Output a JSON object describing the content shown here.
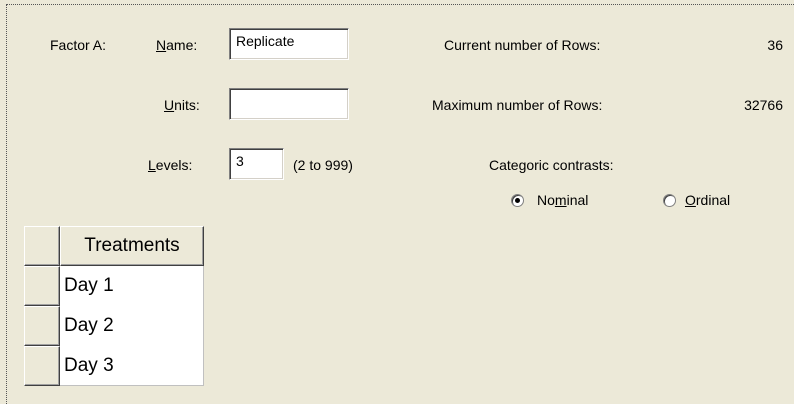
{
  "factor": {
    "heading": "Factor A:",
    "name_label_u": "N",
    "name_label_rest": "ame:",
    "name_value": "Replicate",
    "units_label_u": "U",
    "units_label_rest": "nits:",
    "units_value": "",
    "levels_label_u": "L",
    "levels_label_rest": "evels:",
    "levels_value": "3",
    "levels_range": "(2 to 999)"
  },
  "rows_info": {
    "current_label": "Current number of Rows:",
    "current_value": "36",
    "max_label": "Maximum number of Rows:",
    "max_value": "32766"
  },
  "contrasts": {
    "label": "Categoric contrasts:",
    "nominal_pre": "No",
    "nominal_u": "m",
    "nominal_post": "inal",
    "ordinal_u": "O",
    "ordinal_post": "rdinal",
    "selected": "Nominal"
  },
  "grid": {
    "header": "Treatments",
    "rows": [
      "Day 1",
      "Day 2",
      "Day 3"
    ]
  },
  "colors": {
    "background": "#ECE9D8",
    "field": "#FFFFFF"
  }
}
